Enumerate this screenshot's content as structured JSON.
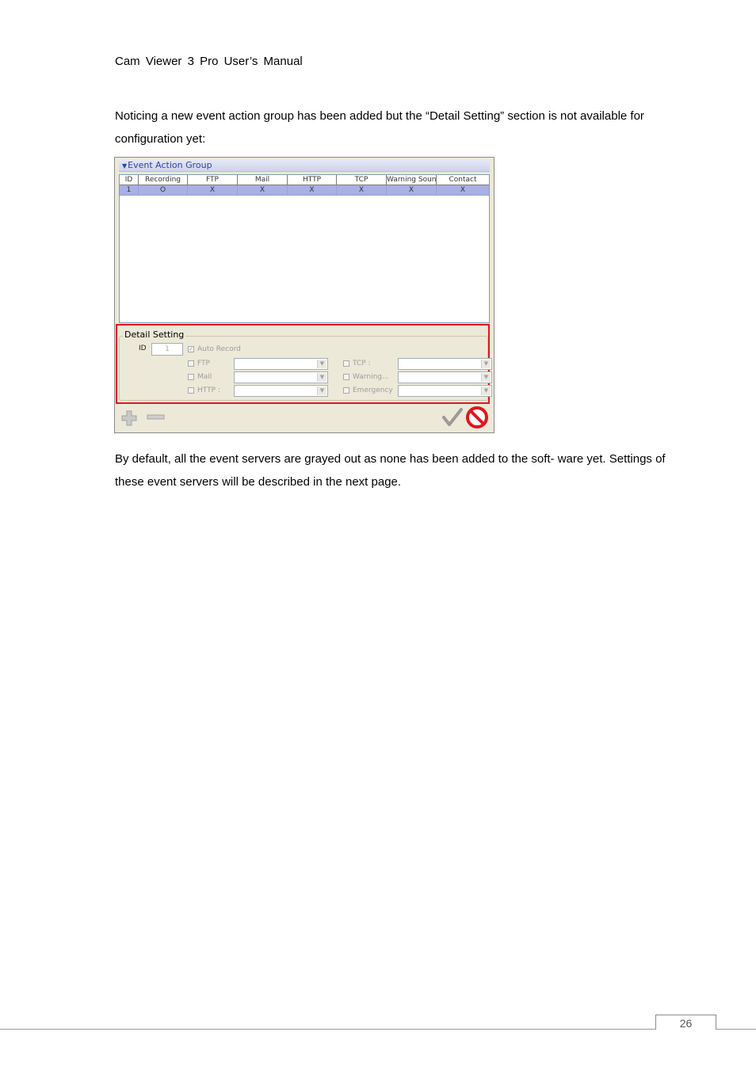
{
  "header": {
    "title": "Cam  Viewer  3  Pro  User’s  Manual"
  },
  "paragraphs": {
    "intro": "Noticing a new event action group has been added but the “Detail Setting” section is not available for configuration yet:",
    "outro": "By default, all the event servers are grayed out as none has been added to the soft- ware yet. Settings of these event servers will be described in the next page."
  },
  "screenshot": {
    "panel_title": "Event Action Group",
    "columns": [
      "ID",
      "Recording",
      "FTP",
      "Mail",
      "HTTP",
      "TCP",
      "Warning Soun",
      "Contact"
    ],
    "rows": [
      [
        "1",
        "O",
        "X",
        "X",
        "X",
        "X",
        "X",
        "X"
      ]
    ],
    "detail": {
      "legend": "Detail Setting",
      "id_label": "ID",
      "id_value": "1",
      "auto_record": "Auto Record",
      "ftp": "FTP",
      "mail": "Mail",
      "http": "HTTP :",
      "tcp": "TCP :",
      "warning": "Warning...",
      "emergency": "Emergency"
    },
    "colors": {
      "selection": "#a8b0e4",
      "highlight": "#e0161d"
    },
    "icons": [
      "add-icon",
      "remove-icon",
      "confirm-check-icon",
      "cancel-icon"
    ]
  },
  "footer": {
    "page_number": "26"
  }
}
